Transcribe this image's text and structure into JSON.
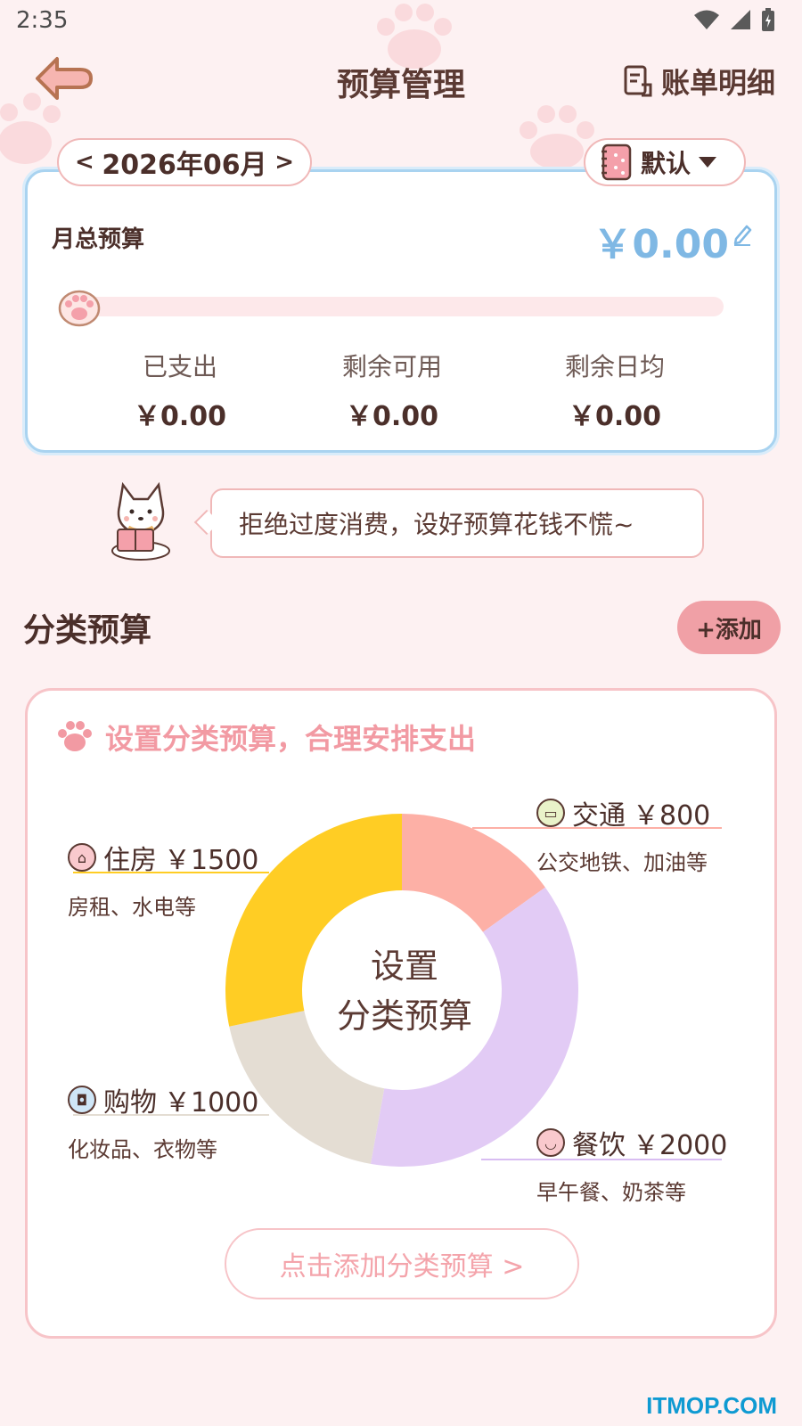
{
  "status_bar": {
    "time": "2:35"
  },
  "header": {
    "title": "预算管理",
    "bill_link": "账单明细"
  },
  "month_selector": {
    "month": "2026年06月",
    "prev": "<",
    "next": ">"
  },
  "book_selector": {
    "label": "默认"
  },
  "budget": {
    "label": "月总预算",
    "amount": "￥0.00",
    "progress": 0,
    "stats": [
      {
        "label": "已支出",
        "value": "￥0.00"
      },
      {
        "label": "剩余可用",
        "value": "￥0.00"
      },
      {
        "label": "剩余日均",
        "value": "￥0.00"
      }
    ]
  },
  "tip": {
    "text": "拒绝过度消费，设好预算花钱不慌~"
  },
  "category_section": {
    "title": "分类预算",
    "add_button": "+添加",
    "hint": "设置分类预算，合理安排支出",
    "center_text_line1": "设置",
    "center_text_line2": "分类预算",
    "cta": "点击添加分类预算 >"
  },
  "chart_data": {
    "type": "pie",
    "categories": [
      "交通",
      "餐饮",
      "购物",
      "住房"
    ],
    "values": [
      800,
      2000,
      1000,
      1500
    ],
    "colors": [
      "#fdb0a6",
      "#e2cbf5",
      "#e4ddd3",
      "#ffcd24"
    ],
    "legend": [
      {
        "name": "交通",
        "amount": "￥800",
        "desc": "公交地铁、加油等",
        "icon": "bus-icon"
      },
      {
        "name": "餐饮",
        "amount": "￥2000",
        "desc": "早午餐、奶茶等",
        "icon": "bowl-icon"
      },
      {
        "name": "购物",
        "amount": "￥1000",
        "desc": "化妆品、衣物等",
        "icon": "bag-icon"
      },
      {
        "name": "住房",
        "amount": "￥1500",
        "desc": "房租、水电等",
        "icon": "house-icon"
      }
    ]
  },
  "watermark": "ITMOP.COM"
}
